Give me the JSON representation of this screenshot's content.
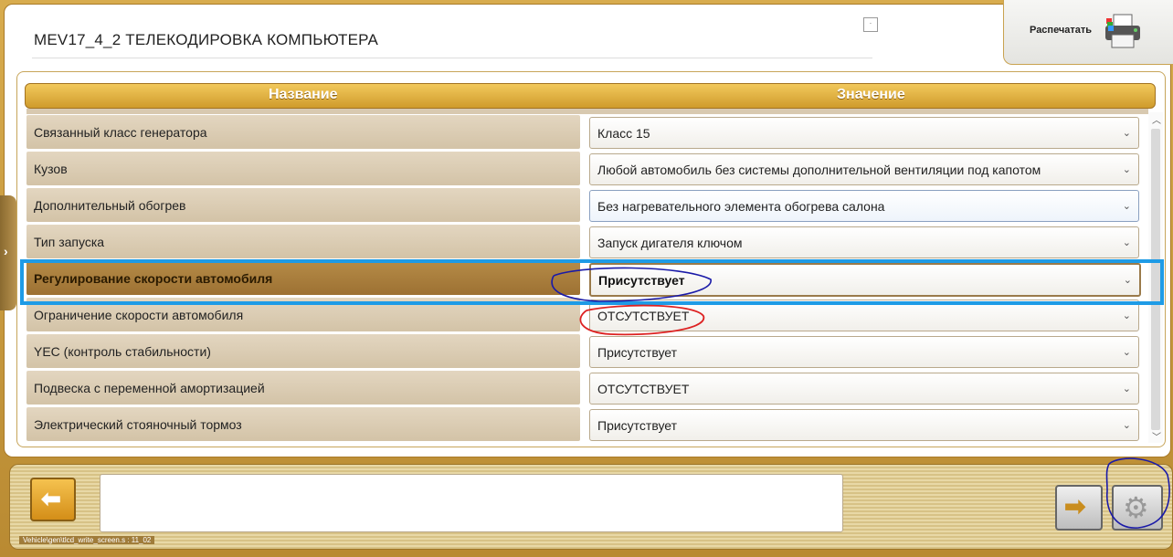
{
  "header": {
    "title": "MEV17_4_2  ТЕЛЕКОДИРОВКА КОМПЬЮТЕРА",
    "print_label": "Распечатать",
    "tiny_icon": "·"
  },
  "table": {
    "col_name": "Название",
    "col_value": "Значение",
    "rows": [
      {
        "name": "Связанный класс генератора",
        "value": "Класс 15"
      },
      {
        "name": "Кузов",
        "value": "Любой  автомобиль без системы дополнительной вентиляции под капотом"
      },
      {
        "name": "Дополнительный обогрев",
        "value": "Без нагревательного элемента обогрева салона"
      },
      {
        "name": "Тип запуска",
        "value": "Запуск дигателя ключом"
      },
      {
        "name": "Регулирование скорости автомобиля",
        "value": "Присутствует"
      },
      {
        "name": "Ограничение скорости автомобиля",
        "value": "ОТСУТСТВУЕТ"
      },
      {
        "name": "YEC (контроль стабильности)",
        "value": "Присутствует"
      },
      {
        "name": "Подвеска с переменной амортизацией",
        "value": "ОТСУТСТВУЕТ"
      },
      {
        "name": "Электрический стояночный тормоз",
        "value": "Присутствует"
      }
    ]
  },
  "footer": {
    "path": "Vehicle\\gen\\tlcd_write_screen.s : 11_02",
    "message": ""
  },
  "icons": {
    "left_tab": "chevron-right-icon",
    "back": "arrow-left-icon",
    "next": "arrow-right-icon",
    "gear": "gear-icon",
    "printer": "printer-icon",
    "chevron": "chevron-down-icon"
  },
  "colors": {
    "highlight_box": "#1e9be6",
    "header_gold": "#d9a535",
    "highlight_row": "#a77d3b"
  }
}
